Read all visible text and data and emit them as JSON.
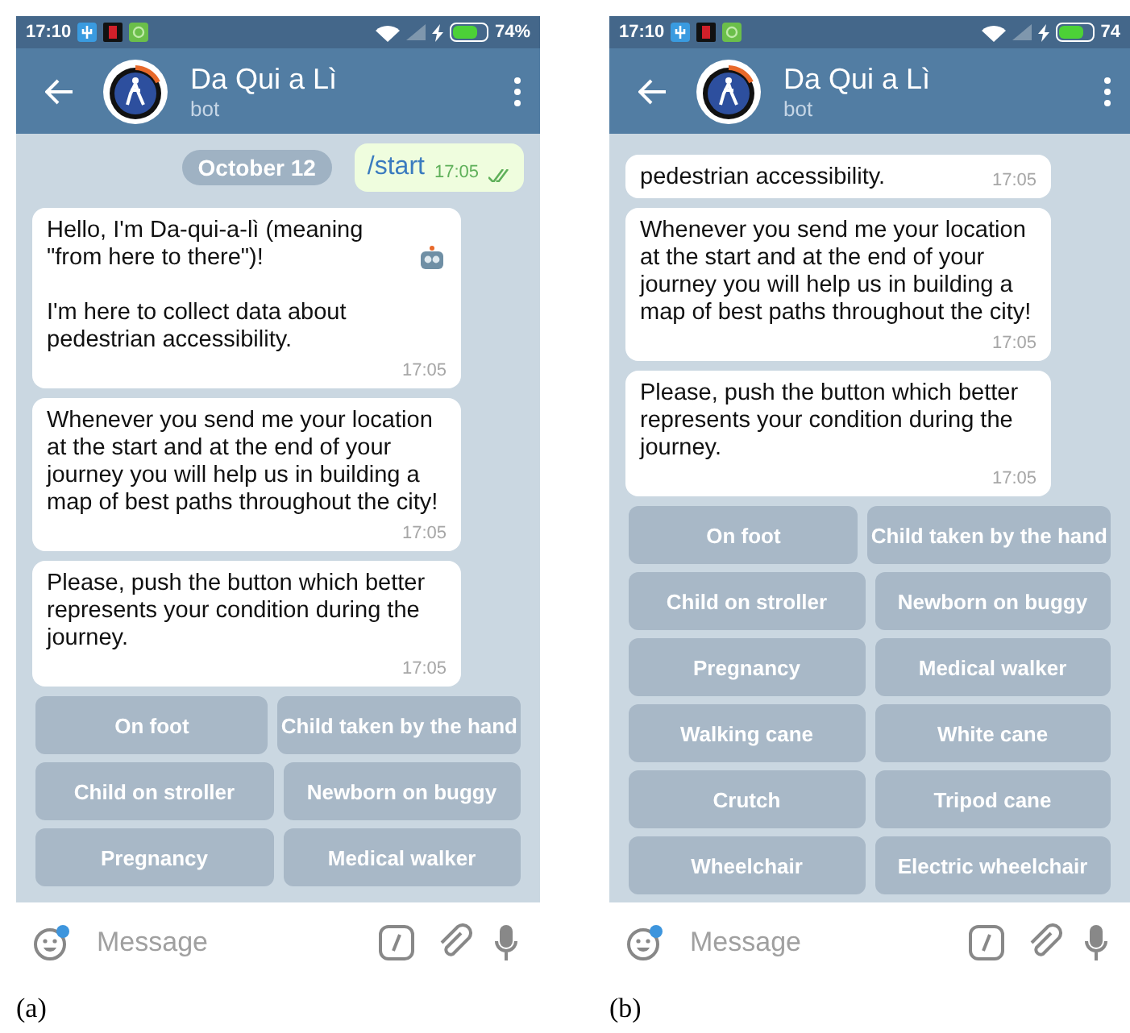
{
  "panels": [
    {
      "caption": "(a)",
      "status_bar": {
        "time": "17:10",
        "battery": "74%"
      },
      "header": {
        "title": "Da Qui a Lì",
        "subtitle": "bot"
      },
      "date_chip": "October 12",
      "outgoing": {
        "text": "/start",
        "time": "17:05",
        "read": true
      },
      "messages": [
        {
          "paragraphs": [
            "Hello, I'm Da-qui-a-lì (meaning \"from here to there\")!",
            "I'm here to collect data about pedestrian accessibility."
          ],
          "bot_emoji": true,
          "time": "17:05"
        },
        {
          "paragraphs": [
            "Whenever you send me your location at the start and at the end of your journey you will help us in building a map of best paths throughout the city!"
          ],
          "bot_emoji": false,
          "time": "17:05"
        },
        {
          "paragraphs": [
            "Please, push the button which better represents your condition during the journey."
          ],
          "bot_emoji": false,
          "time": "17:05"
        }
      ],
      "keyboard": [
        [
          {
            "label": "On foot"
          },
          {
            "label": "Child taken by the hand"
          }
        ],
        [
          {
            "label": "Child on stroller"
          },
          {
            "label": "Newborn on buggy"
          }
        ],
        [
          {
            "label": "Pregnancy"
          },
          {
            "label": "Medical walker"
          }
        ]
      ],
      "input": {
        "placeholder": "Message"
      }
    },
    {
      "caption": "(b)",
      "status_bar": {
        "time": "17:10",
        "battery": "74"
      },
      "header": {
        "title": "Da Qui a Lì",
        "subtitle": "bot"
      },
      "messages": [
        {
          "paragraphs": [
            "pedestrian accessibility."
          ],
          "bot_emoji": false,
          "time": "17:05"
        },
        {
          "paragraphs": [
            "Whenever you send me your location at the start and at the end of your journey you will help us in building a map of best paths throughout the city!"
          ],
          "bot_emoji": false,
          "time": "17:05"
        },
        {
          "paragraphs": [
            "Please, push the button which better represents your condition during the journey."
          ],
          "bot_emoji": false,
          "time": "17:05"
        }
      ],
      "keyboard": [
        [
          {
            "label": "On foot"
          },
          {
            "label": "Child taken by the hand"
          }
        ],
        [
          {
            "label": "Child on stroller"
          },
          {
            "label": "Newborn on buggy"
          }
        ],
        [
          {
            "label": "Pregnancy"
          },
          {
            "label": "Medical walker"
          }
        ],
        [
          {
            "label": "Walking cane"
          },
          {
            "label": "White cane"
          }
        ],
        [
          {
            "label": "Crutch"
          },
          {
            "label": "Tripod cane"
          }
        ],
        [
          {
            "label": "Wheelchair"
          },
          {
            "label": "Electric wheelchair"
          }
        ]
      ],
      "input": {
        "placeholder": "Message"
      }
    }
  ]
}
